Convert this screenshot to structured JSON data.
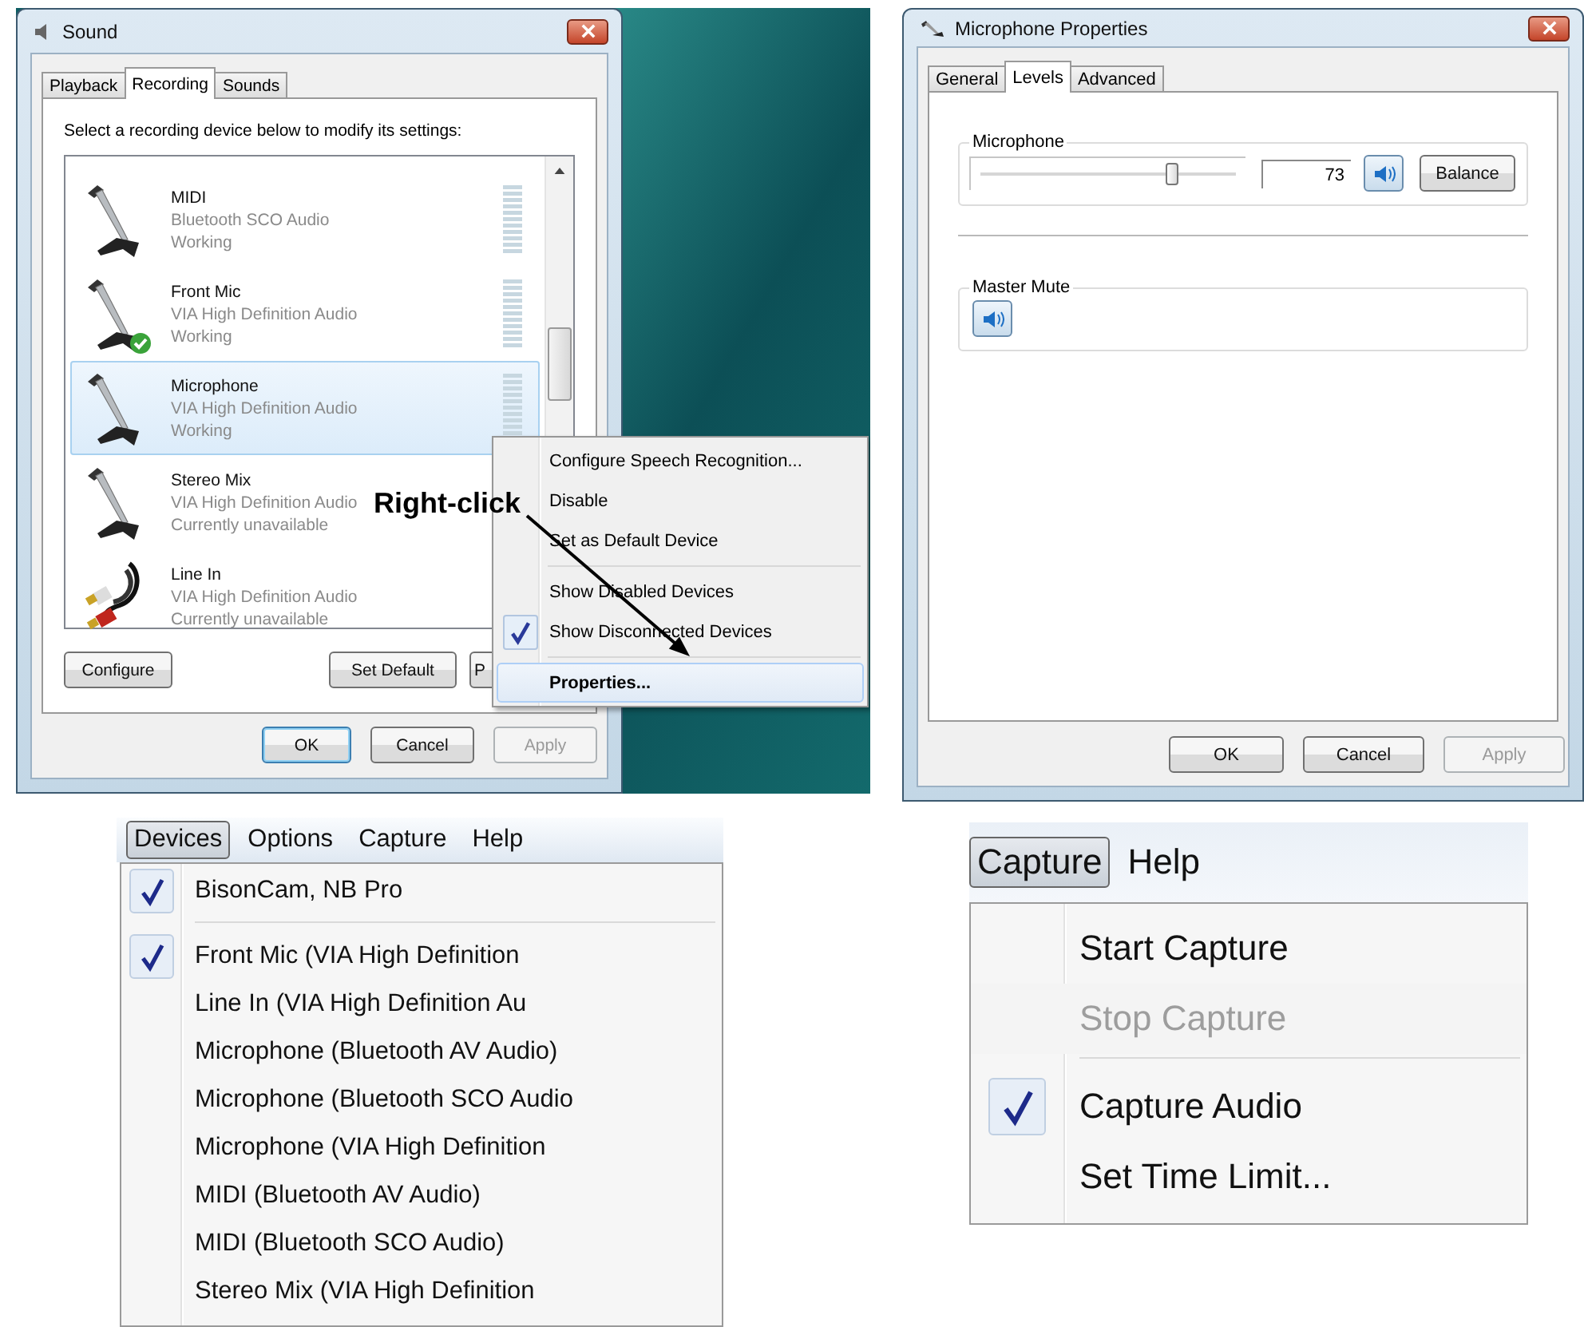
{
  "sound_dialog": {
    "title": "Sound",
    "tabs": [
      {
        "label": "Playback",
        "selected": false
      },
      {
        "label": "Recording",
        "selected": true
      },
      {
        "label": "Sounds",
        "selected": false
      }
    ],
    "instruction": "Select a recording device below to modify its settings:",
    "devices": [
      {
        "name": "MIDI",
        "driver": "Bluetooth SCO Audio",
        "status": "Working",
        "kind": "microphone",
        "default": false,
        "selected": false
      },
      {
        "name": "Front Mic",
        "driver": "VIA High Definition Audio",
        "status": "Working",
        "kind": "microphone",
        "default": true,
        "selected": false
      },
      {
        "name": "Microphone",
        "driver": "VIA High Definition Audio",
        "status": "Working",
        "kind": "microphone",
        "default": false,
        "selected": true
      },
      {
        "name": "Stereo Mix",
        "driver": "VIA High Definition Audio",
        "status": "Currently unavailable",
        "kind": "microphone",
        "default": false,
        "selected": false
      },
      {
        "name": "Line In",
        "driver": "VIA High Definition Audio",
        "status": "Currently unavailable",
        "kind": "cable",
        "default": false,
        "selected": false
      }
    ],
    "buttons": [
      {
        "label": "Configure"
      },
      {
        "label": "Set Default"
      },
      {
        "label": "P"
      }
    ],
    "dialog_buttons": [
      {
        "label": "OK",
        "default": true,
        "disabled": false
      },
      {
        "label": "Cancel",
        "default": false,
        "disabled": false
      },
      {
        "label": "Apply",
        "default": false,
        "disabled": true
      }
    ]
  },
  "context_menu": {
    "items": [
      {
        "kind": "item",
        "label": "Configure Speech Recognition...",
        "checked": false,
        "bold": false,
        "selected": false
      },
      {
        "kind": "item",
        "label": "Disable",
        "checked": false,
        "bold": false,
        "selected": false
      },
      {
        "kind": "item",
        "label": "Set as Default Device",
        "checked": false,
        "bold": false,
        "selected": false
      },
      {
        "kind": "separator"
      },
      {
        "kind": "item",
        "label": "Show Disabled Devices",
        "checked": false,
        "bold": false,
        "selected": false
      },
      {
        "kind": "item",
        "label": "Show Disconnected Devices",
        "checked": true,
        "bold": false,
        "selected": false
      },
      {
        "kind": "separator"
      },
      {
        "kind": "item",
        "label": "Properties...",
        "checked": false,
        "bold": true,
        "selected": true
      }
    ]
  },
  "annotation": {
    "text": "Right-click"
  },
  "properties_dialog": {
    "title": "Microphone Properties",
    "tabs": [
      {
        "label": "General",
        "selected": false
      },
      {
        "label": "Levels",
        "selected": true
      },
      {
        "label": "Advanced",
        "selected": false
      }
    ],
    "microphone": {
      "label": "Microphone",
      "level": 0.73,
      "value": "73",
      "muted": false,
      "balance_button": "Balance"
    },
    "master_mute": {
      "label": "Master Mute",
      "muted": false
    },
    "buttons": [
      {
        "label": "OK",
        "default": false,
        "disabled": false
      },
      {
        "label": "Cancel",
        "default": false,
        "disabled": false
      },
      {
        "label": "Apply",
        "default": false,
        "disabled": true
      }
    ]
  },
  "devices_menu": {
    "menubar": [
      {
        "label": "Devices",
        "selected": true
      },
      {
        "label": "Options",
        "selected": false
      },
      {
        "label": "Capture",
        "selected": false
      },
      {
        "label": "Help",
        "selected": false
      }
    ],
    "items": [
      {
        "kind": "item",
        "label": "BisonCam, NB Pro",
        "checked": true
      },
      {
        "kind": "separator"
      },
      {
        "kind": "item",
        "label": "Front Mic (VIA High Definition",
        "checked": true
      },
      {
        "kind": "item",
        "label": "Line In (VIA High Definition Au",
        "checked": false
      },
      {
        "kind": "item",
        "label": "Microphone (Bluetooth AV Audio)",
        "checked": false
      },
      {
        "kind": "item",
        "label": "Microphone (Bluetooth SCO Audio",
        "checked": false
      },
      {
        "kind": "item",
        "label": "Microphone (VIA High Definition",
        "checked": false
      },
      {
        "kind": "item",
        "label": "MIDI (Bluetooth AV Audio)",
        "checked": false
      },
      {
        "kind": "item",
        "label": "MIDI (Bluetooth SCO Audio)",
        "checked": false
      },
      {
        "kind": "item",
        "label": "Stereo Mix (VIA High Definition",
        "checked": false
      }
    ]
  },
  "capture_menu": {
    "menubar": [
      {
        "label": "Capture",
        "selected": true
      },
      {
        "label": "Help",
        "selected": false
      }
    ],
    "items": [
      {
        "kind": "item",
        "label": "Start Capture",
        "checked": false,
        "disabled": false
      },
      {
        "kind": "item",
        "label": "Stop Capture",
        "checked": false,
        "disabled": true
      },
      {
        "kind": "separator"
      },
      {
        "kind": "item",
        "label": "Capture Audio",
        "checked": true,
        "disabled": false
      },
      {
        "kind": "item",
        "label": "Set Time Limit...",
        "checked": false,
        "disabled": false
      }
    ]
  }
}
